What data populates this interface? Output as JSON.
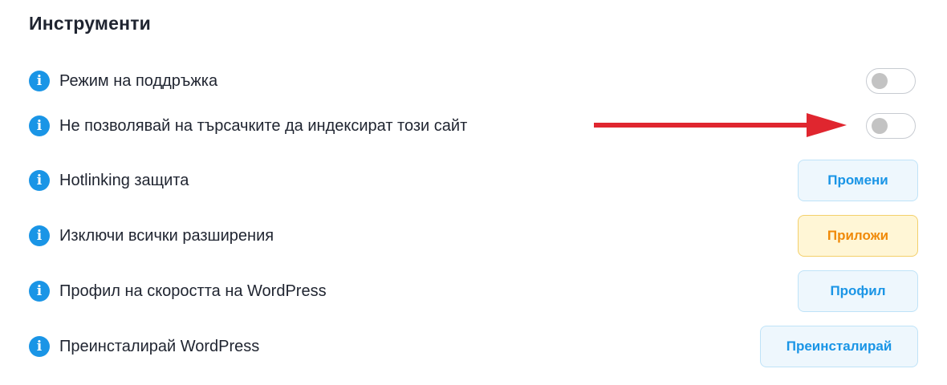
{
  "section": {
    "title": "Инструменти"
  },
  "rows": [
    {
      "label": "Режим на поддръжка",
      "control": "toggle",
      "state": "off"
    },
    {
      "label": "Не позволявай на търсачките да индексират този сайт",
      "control": "toggle",
      "state": "off"
    },
    {
      "label": "Hotlinking защита",
      "control": "button",
      "button_label": "Промени"
    },
    {
      "label": "Изключи всички разширения",
      "control": "button",
      "button_label": "Приложи"
    },
    {
      "label": "Профил на скоростта на WordPress",
      "control": "button",
      "button_label": "Профил"
    },
    {
      "label": "Преинсталирай WordPress",
      "control": "button",
      "button_label": "Преинсталирай"
    }
  ],
  "icons": {
    "info": "info-icon",
    "annotation": "red-arrow-icon"
  },
  "colors": {
    "accent_blue": "#1a95e6",
    "warning_orange": "#f08a0a",
    "warning_bg": "#fff6d6",
    "arrow_red": "#e0262f"
  }
}
